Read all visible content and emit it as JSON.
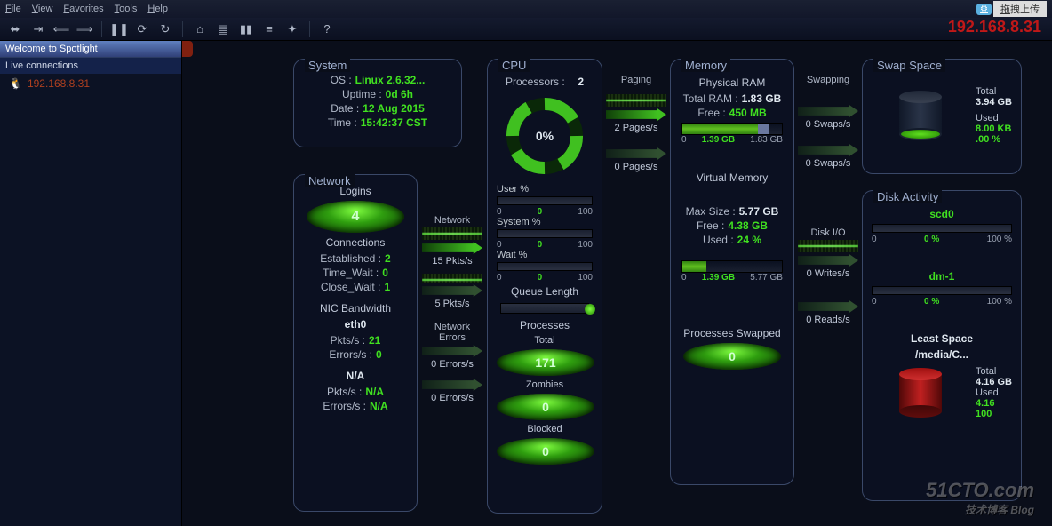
{
  "menubar": [
    "File",
    "View",
    "Favorites",
    "Tools",
    "Help"
  ],
  "upload": {
    "icon": "⚙",
    "label": "拖拽上传"
  },
  "top_ip": "192.168.8.31",
  "left": {
    "head": "Welcome to Spotlight",
    "sub": "Live connections",
    "conn_ip": "192.168.8.31"
  },
  "system": {
    "title": "System",
    "os_k": "OS :",
    "os_v": "Linux 2.6.32...",
    "up_k": "Uptime :",
    "up_v": "0d 6h",
    "date_k": "Date :",
    "date_v": "12 Aug 2015",
    "time_k": "Time :",
    "time_v": "15:42:37 CST"
  },
  "network": {
    "title": "Network",
    "logins_h": "Logins",
    "logins_v": "4",
    "conn_h": "Connections",
    "est_k": "Established :",
    "est_v": "2",
    "tw_k": "Time_Wait :",
    "tw_v": "0",
    "cw_k": "Close_Wait :",
    "cw_v": "1",
    "bw_h": "NIC Bandwidth",
    "if0": "eth0",
    "if0_pk": "Pkts/s :",
    "if0_pv": "21",
    "if0_ek": "Errors/s :",
    "if0_ev": "0",
    "if1": "N/A",
    "if1_pk": "Pkts/s :",
    "if1_pv": "N/A",
    "if1_ek": "Errors/s :",
    "if1_ev": "N/A"
  },
  "netflow": {
    "h1": "Network",
    "v1": "15 Pkts/s",
    "v2": "5 Pkts/s",
    "h3": "Network Errors",
    "v3": "0 Errors/s",
    "v4": "0 Errors/s"
  },
  "cpu": {
    "title": "CPU",
    "proc_k": "Processors :",
    "proc_v": "2",
    "donut": "0%",
    "user_h": "User %",
    "user_lo": "0",
    "user_mid": "0",
    "user_hi": "100",
    "sys_h": "System %",
    "sys_lo": "0",
    "sys_mid": "0",
    "sys_hi": "100",
    "wait_h": "Wait %",
    "wait_lo": "0",
    "wait_mid": "0",
    "wait_hi": "100",
    "ql_h": "Queue Length",
    "proc_h": "Processes",
    "total_h": "Total",
    "total_v": "171",
    "zomb_h": "Zombies",
    "zomb_v": "0",
    "block_h": "Blocked",
    "block_v": "0"
  },
  "paging": {
    "h": "Paging",
    "v1": "2 Pages/s",
    "v2": "0 Pages/s"
  },
  "memory": {
    "title": "Memory",
    "phys_h": "Physical RAM",
    "tram_k": "Total RAM :",
    "tram_v": "1.83 GB",
    "free_k": "Free :",
    "free_v": "450 MB",
    "bar_lo": "0",
    "bar_mid": "1.39 GB",
    "bar_hi": "1.83 GB",
    "vm_h": "Virtual Memory",
    "max_k": "Max Size :",
    "max_v": "5.77 GB",
    "vfree_k": "Free :",
    "vfree_v": "4.38 GB",
    "used_k": "Used :",
    "used_v": "24 %",
    "vbar_lo": "0",
    "vbar_mid": "1.39 GB",
    "vbar_hi": "5.77 GB",
    "swap_h": "Processes Swapped",
    "swap_v": "0"
  },
  "swapping": {
    "h": "Swapping",
    "v1": "0 Swaps/s",
    "v2": "0 Swaps/s"
  },
  "diskio": {
    "h": "Disk I/O",
    "v1": "0 Writes/s",
    "v2": "0 Reads/s"
  },
  "swap": {
    "title": "Swap Space",
    "total_k": "Total",
    "total_v": "3.94 GB",
    "used_k": "Used",
    "used_v": "8.00 KB",
    "pct": ".00 %"
  },
  "disk": {
    "title": "Disk Activity",
    "d0": "scd0",
    "d0_lo": "0",
    "d0_mid": "0 %",
    "d0_hi": "100 %",
    "d1": "dm-1",
    "d1_lo": "0",
    "d1_mid": "0 %",
    "d1_hi": "100 %",
    "least_h": "Least Space",
    "mount": "/media/C...",
    "lt_k": "Total",
    "lt_v": "4.16 GB",
    "lu_k": "Used",
    "lu_v": "4.16",
    "lp": "100"
  },
  "watermark": {
    "l1": "51CTO.com",
    "l2": "技术博客   Blog"
  }
}
